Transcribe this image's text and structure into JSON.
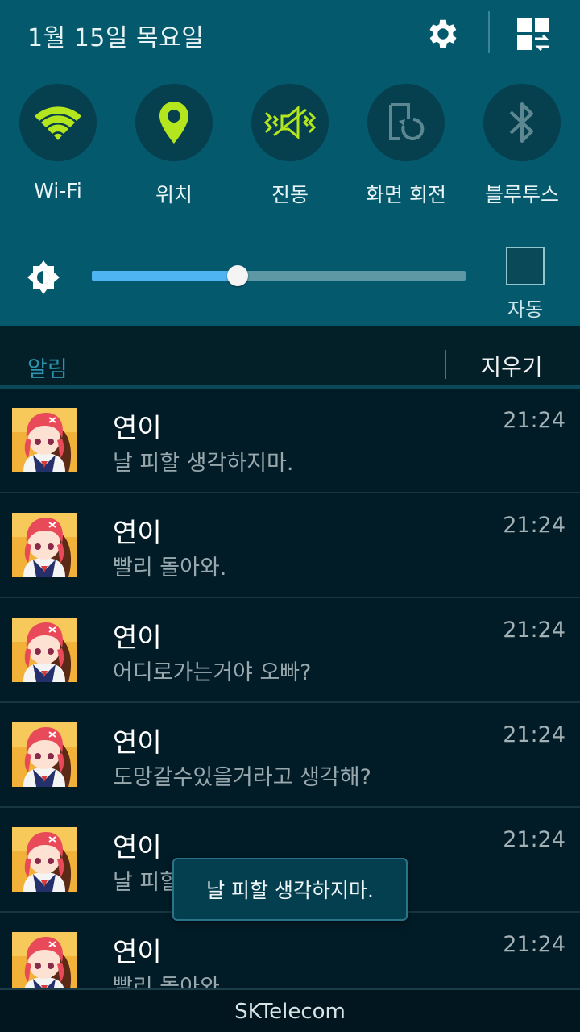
{
  "status": {
    "date": "1월 15일 목요일"
  },
  "quick_settings": [
    {
      "label": "Wi-Fi",
      "icon": "wifi-icon",
      "active": true
    },
    {
      "label": "위치",
      "icon": "location-icon",
      "active": true
    },
    {
      "label": "진동",
      "icon": "vibrate-icon",
      "active": true
    },
    {
      "label": "화면 회전",
      "icon": "rotate-icon",
      "active": false
    },
    {
      "label": "블루투스",
      "icon": "bluetooth-icon",
      "active": false
    }
  ],
  "brightness": {
    "level": 0.39,
    "auto_label": "자동"
  },
  "notifications_header": {
    "title": "알림",
    "clear_label": "지우기"
  },
  "notifications": [
    {
      "sender": "연이",
      "message": "날 피할 생각하지마.",
      "time": "21:24"
    },
    {
      "sender": "연이",
      "message": "빨리 돌아와.",
      "time": "21:24"
    },
    {
      "sender": "연이",
      "message": "어디로가는거야 오빠?",
      "time": "21:24"
    },
    {
      "sender": "연이",
      "message": "도망갈수있을거라고 생각해?",
      "time": "21:24"
    },
    {
      "sender": "연이",
      "message": "날 피할 생각하지마.",
      "time": "21:24"
    },
    {
      "sender": "연이",
      "message": "빨리 돌아와.",
      "time": "21:24"
    }
  ],
  "toast": {
    "text": "날 피할 생각하지마."
  },
  "carrier": "SKTelecom",
  "colors": {
    "panel": "#05596d",
    "active_icon": "#b4e61e",
    "inactive_icon": "#5d8892",
    "background": "#021c27",
    "accent": "#2e93ae",
    "slider_fill": "#4fb4f2"
  }
}
